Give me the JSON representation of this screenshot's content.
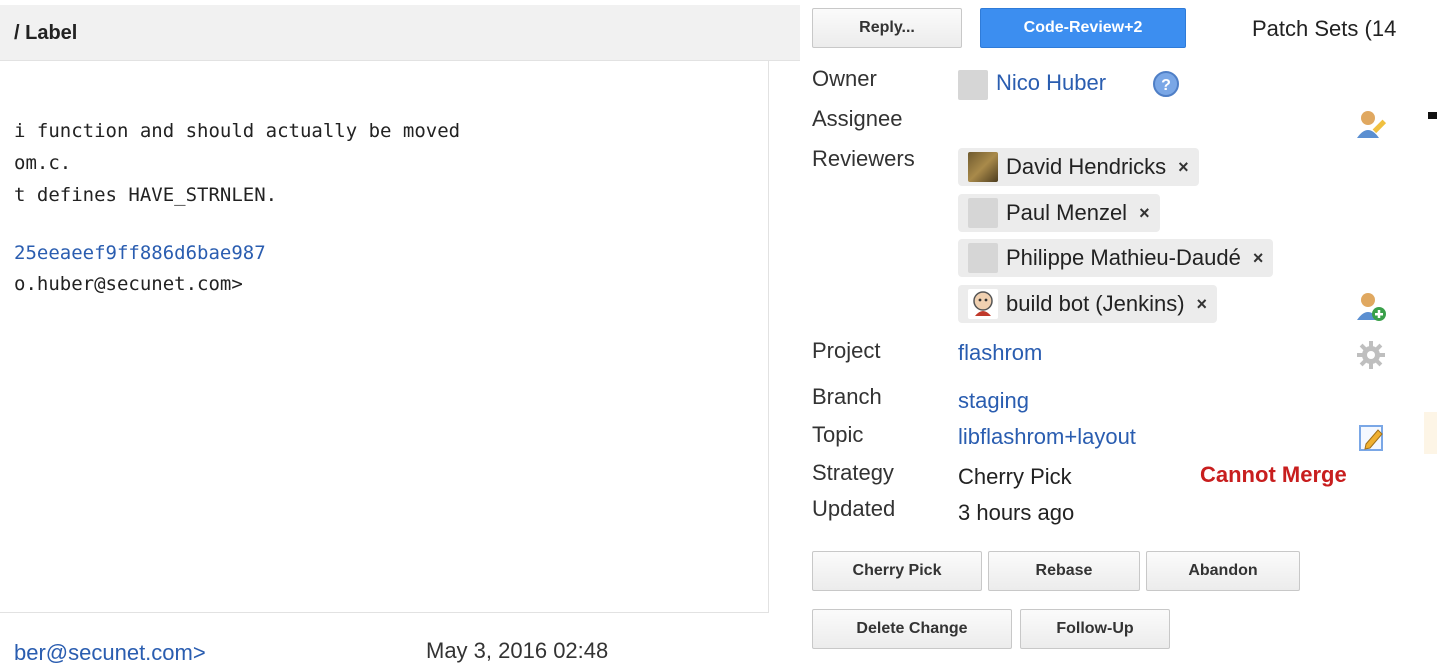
{
  "header": {
    "title": "/ Label"
  },
  "commit_message": {
    "lines": [
      "i function and should actually be moved",
      "om.c.",
      "t defines HAVE_STRNLEN."
    ],
    "change_id_fragment": "25eeaeef9ff886d6bae987",
    "signoff_fragment": "o.huber@secunet.com>"
  },
  "author_row": {
    "email_fragment": "ber@secunet.com>",
    "date": "May 3, 2016 02:48"
  },
  "toolbar": {
    "reply_label": "Reply...",
    "code_review_label": "Code-Review+2",
    "patch_sets_label": "Patch Sets (14"
  },
  "info": {
    "owner_label": "Owner",
    "owner_name": "Nico Huber",
    "assignee_label": "Assignee",
    "reviewers_label": "Reviewers",
    "reviewers": [
      "David Hendricks",
      "Paul Menzel",
      "Philippe Mathieu-Daudé",
      "build bot (Jenkins)"
    ],
    "remove_symbol": "×",
    "project_label": "Project",
    "project_value": "flashrom",
    "branch_label": "Branch",
    "branch_value": "staging",
    "topic_label": "Topic",
    "topic_value": "libflashrom+layout",
    "strategy_label": "Strategy",
    "strategy_value": "Cherry Pick",
    "merge_status": "Cannot Merge",
    "updated_label": "Updated",
    "updated_value": "3 hours ago"
  },
  "actions": {
    "cherry_pick": "Cherry Pick",
    "rebase": "Rebase",
    "abandon": "Abandon",
    "delete_change": "Delete Change",
    "follow_up": "Follow-Up"
  },
  "colors": {
    "link": "#2a5db0",
    "primary": "#3c8ef0",
    "error": "#c81e1e"
  },
  "icons": [
    "help-icon",
    "edit-assignee-icon",
    "add-reviewer-icon",
    "settings-gear-icon",
    "edit-topic-icon"
  ]
}
